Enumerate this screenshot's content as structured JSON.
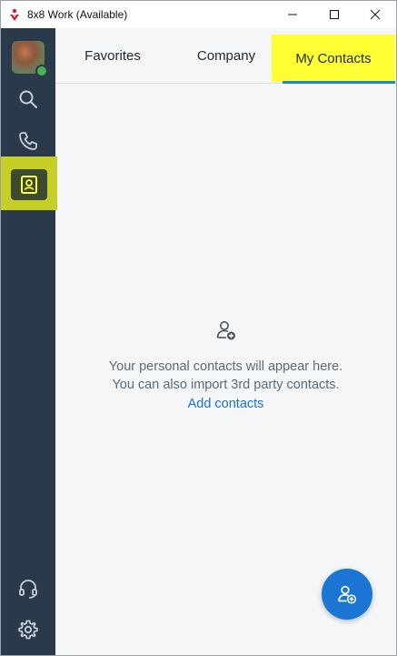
{
  "window": {
    "title": "8x8 Work (Available)"
  },
  "sidebar": {
    "items": [
      {
        "name": "avatar",
        "icon": "user-avatar"
      },
      {
        "name": "search",
        "icon": "search-icon"
      },
      {
        "name": "calls",
        "icon": "phone-icon"
      },
      {
        "name": "contacts",
        "icon": "contacts-icon",
        "selected": true
      },
      {
        "name": "help",
        "icon": "headset-icon"
      },
      {
        "name": "settings",
        "icon": "gear-icon"
      }
    ],
    "presence_status": "Available"
  },
  "tabs": [
    {
      "label": "Favorites"
    },
    {
      "label": "Company"
    },
    {
      "label": "My Contacts",
      "active": true
    }
  ],
  "empty_state": {
    "icon": "add-contact-icon",
    "line1": "Your personal contacts will appear here.",
    "line2": "You can also import 3rd party contacts.",
    "link": "Add contacts"
  },
  "fab": {
    "icon": "add-contact-icon"
  },
  "colors": {
    "sidebar": "#2b3a4a",
    "accent": "#1a76d2",
    "highlight": "#ffff33",
    "link": "#1a73c7"
  }
}
